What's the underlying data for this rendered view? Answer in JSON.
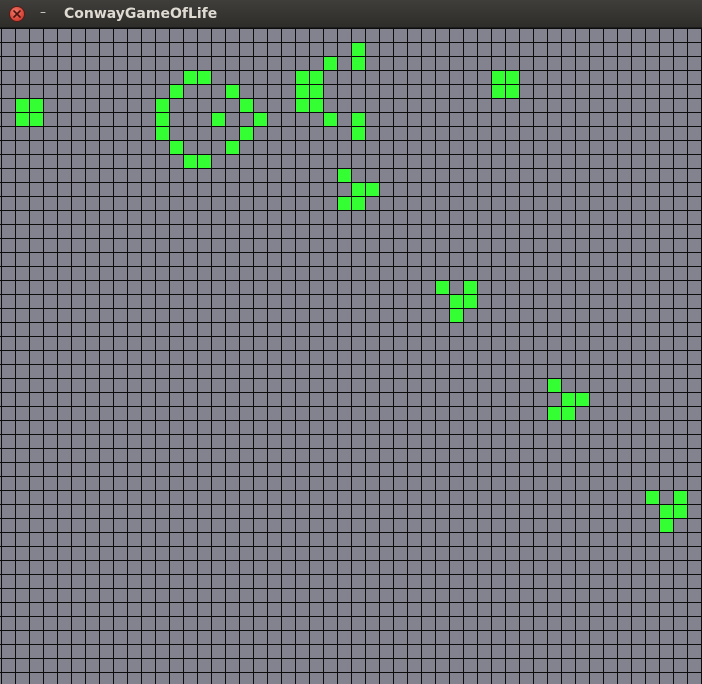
{
  "window": {
    "title": "ConwayGameOfLife",
    "minimize_glyph": "–"
  },
  "colors": {
    "titlebar": "#33322f",
    "board_background": "#83838f",
    "grid_line": "#0c0c0c",
    "live_cell": "#33ff33",
    "close_button": "#d9473b"
  },
  "icons": [
    "close-icon",
    "minimize-icon"
  ],
  "board": {
    "columns": 50,
    "rows": 47,
    "live_cells": [
      [
        25,
        1
      ],
      [
        23,
        2
      ],
      [
        25,
        2
      ],
      [
        13,
        3
      ],
      [
        14,
        3
      ],
      [
        21,
        3
      ],
      [
        22,
        3
      ],
      [
        35,
        3
      ],
      [
        36,
        3
      ],
      [
        12,
        4
      ],
      [
        16,
        4
      ],
      [
        21,
        4
      ],
      [
        22,
        4
      ],
      [
        35,
        4
      ],
      [
        36,
        4
      ],
      [
        1,
        5
      ],
      [
        2,
        5
      ],
      [
        11,
        5
      ],
      [
        17,
        5
      ],
      [
        21,
        5
      ],
      [
        22,
        5
      ],
      [
        1,
        6
      ],
      [
        2,
        6
      ],
      [
        11,
        6
      ],
      [
        15,
        6
      ],
      [
        18,
        6
      ],
      [
        23,
        6
      ],
      [
        25,
        6
      ],
      [
        11,
        7
      ],
      [
        17,
        7
      ],
      [
        25,
        7
      ],
      [
        12,
        8
      ],
      [
        16,
        8
      ],
      [
        13,
        9
      ],
      [
        14,
        9
      ],
      [
        24,
        10
      ],
      [
        25,
        11
      ],
      [
        26,
        11
      ],
      [
        24,
        12
      ],
      [
        25,
        12
      ],
      [
        31,
        18
      ],
      [
        33,
        18
      ],
      [
        32,
        19
      ],
      [
        33,
        19
      ],
      [
        32,
        20
      ],
      [
        39,
        25
      ],
      [
        40,
        26
      ],
      [
        41,
        26
      ],
      [
        39,
        27
      ],
      [
        40,
        27
      ],
      [
        46,
        33
      ],
      [
        48,
        33
      ],
      [
        47,
        34
      ],
      [
        48,
        34
      ],
      [
        47,
        35
      ]
    ]
  }
}
